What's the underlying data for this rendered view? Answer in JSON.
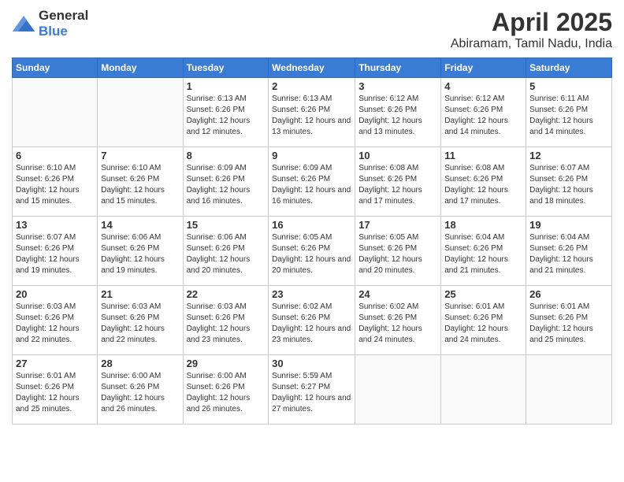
{
  "logo": {
    "general": "General",
    "blue": "Blue"
  },
  "header": {
    "title": "April 2025",
    "subtitle": "Abiramam, Tamil Nadu, India"
  },
  "weekdays": [
    "Sunday",
    "Monday",
    "Tuesday",
    "Wednesday",
    "Thursday",
    "Friday",
    "Saturday"
  ],
  "weeks": [
    [
      {
        "day": "",
        "info": ""
      },
      {
        "day": "",
        "info": ""
      },
      {
        "day": "1",
        "info": "Sunrise: 6:13 AM\nSunset: 6:26 PM\nDaylight: 12 hours and 12 minutes."
      },
      {
        "day": "2",
        "info": "Sunrise: 6:13 AM\nSunset: 6:26 PM\nDaylight: 12 hours and 13 minutes."
      },
      {
        "day": "3",
        "info": "Sunrise: 6:12 AM\nSunset: 6:26 PM\nDaylight: 12 hours and 13 minutes."
      },
      {
        "day": "4",
        "info": "Sunrise: 6:12 AM\nSunset: 6:26 PM\nDaylight: 12 hours and 14 minutes."
      },
      {
        "day": "5",
        "info": "Sunrise: 6:11 AM\nSunset: 6:26 PM\nDaylight: 12 hours and 14 minutes."
      }
    ],
    [
      {
        "day": "6",
        "info": "Sunrise: 6:10 AM\nSunset: 6:26 PM\nDaylight: 12 hours and 15 minutes."
      },
      {
        "day": "7",
        "info": "Sunrise: 6:10 AM\nSunset: 6:26 PM\nDaylight: 12 hours and 15 minutes."
      },
      {
        "day": "8",
        "info": "Sunrise: 6:09 AM\nSunset: 6:26 PM\nDaylight: 12 hours and 16 minutes."
      },
      {
        "day": "9",
        "info": "Sunrise: 6:09 AM\nSunset: 6:26 PM\nDaylight: 12 hours and 16 minutes."
      },
      {
        "day": "10",
        "info": "Sunrise: 6:08 AM\nSunset: 6:26 PM\nDaylight: 12 hours and 17 minutes."
      },
      {
        "day": "11",
        "info": "Sunrise: 6:08 AM\nSunset: 6:26 PM\nDaylight: 12 hours and 17 minutes."
      },
      {
        "day": "12",
        "info": "Sunrise: 6:07 AM\nSunset: 6:26 PM\nDaylight: 12 hours and 18 minutes."
      }
    ],
    [
      {
        "day": "13",
        "info": "Sunrise: 6:07 AM\nSunset: 6:26 PM\nDaylight: 12 hours and 19 minutes."
      },
      {
        "day": "14",
        "info": "Sunrise: 6:06 AM\nSunset: 6:26 PM\nDaylight: 12 hours and 19 minutes."
      },
      {
        "day": "15",
        "info": "Sunrise: 6:06 AM\nSunset: 6:26 PM\nDaylight: 12 hours and 20 minutes."
      },
      {
        "day": "16",
        "info": "Sunrise: 6:05 AM\nSunset: 6:26 PM\nDaylight: 12 hours and 20 minutes."
      },
      {
        "day": "17",
        "info": "Sunrise: 6:05 AM\nSunset: 6:26 PM\nDaylight: 12 hours and 20 minutes."
      },
      {
        "day": "18",
        "info": "Sunrise: 6:04 AM\nSunset: 6:26 PM\nDaylight: 12 hours and 21 minutes."
      },
      {
        "day": "19",
        "info": "Sunrise: 6:04 AM\nSunset: 6:26 PM\nDaylight: 12 hours and 21 minutes."
      }
    ],
    [
      {
        "day": "20",
        "info": "Sunrise: 6:03 AM\nSunset: 6:26 PM\nDaylight: 12 hours and 22 minutes."
      },
      {
        "day": "21",
        "info": "Sunrise: 6:03 AM\nSunset: 6:26 PM\nDaylight: 12 hours and 22 minutes."
      },
      {
        "day": "22",
        "info": "Sunrise: 6:03 AM\nSunset: 6:26 PM\nDaylight: 12 hours and 23 minutes."
      },
      {
        "day": "23",
        "info": "Sunrise: 6:02 AM\nSunset: 6:26 PM\nDaylight: 12 hours and 23 minutes."
      },
      {
        "day": "24",
        "info": "Sunrise: 6:02 AM\nSunset: 6:26 PM\nDaylight: 12 hours and 24 minutes."
      },
      {
        "day": "25",
        "info": "Sunrise: 6:01 AM\nSunset: 6:26 PM\nDaylight: 12 hours and 24 minutes."
      },
      {
        "day": "26",
        "info": "Sunrise: 6:01 AM\nSunset: 6:26 PM\nDaylight: 12 hours and 25 minutes."
      }
    ],
    [
      {
        "day": "27",
        "info": "Sunrise: 6:01 AM\nSunset: 6:26 PM\nDaylight: 12 hours and 25 minutes."
      },
      {
        "day": "28",
        "info": "Sunrise: 6:00 AM\nSunset: 6:26 PM\nDaylight: 12 hours and 26 minutes."
      },
      {
        "day": "29",
        "info": "Sunrise: 6:00 AM\nSunset: 6:26 PM\nDaylight: 12 hours and 26 minutes."
      },
      {
        "day": "30",
        "info": "Sunrise: 5:59 AM\nSunset: 6:27 PM\nDaylight: 12 hours and 27 minutes."
      },
      {
        "day": "",
        "info": ""
      },
      {
        "day": "",
        "info": ""
      },
      {
        "day": "",
        "info": ""
      }
    ]
  ]
}
